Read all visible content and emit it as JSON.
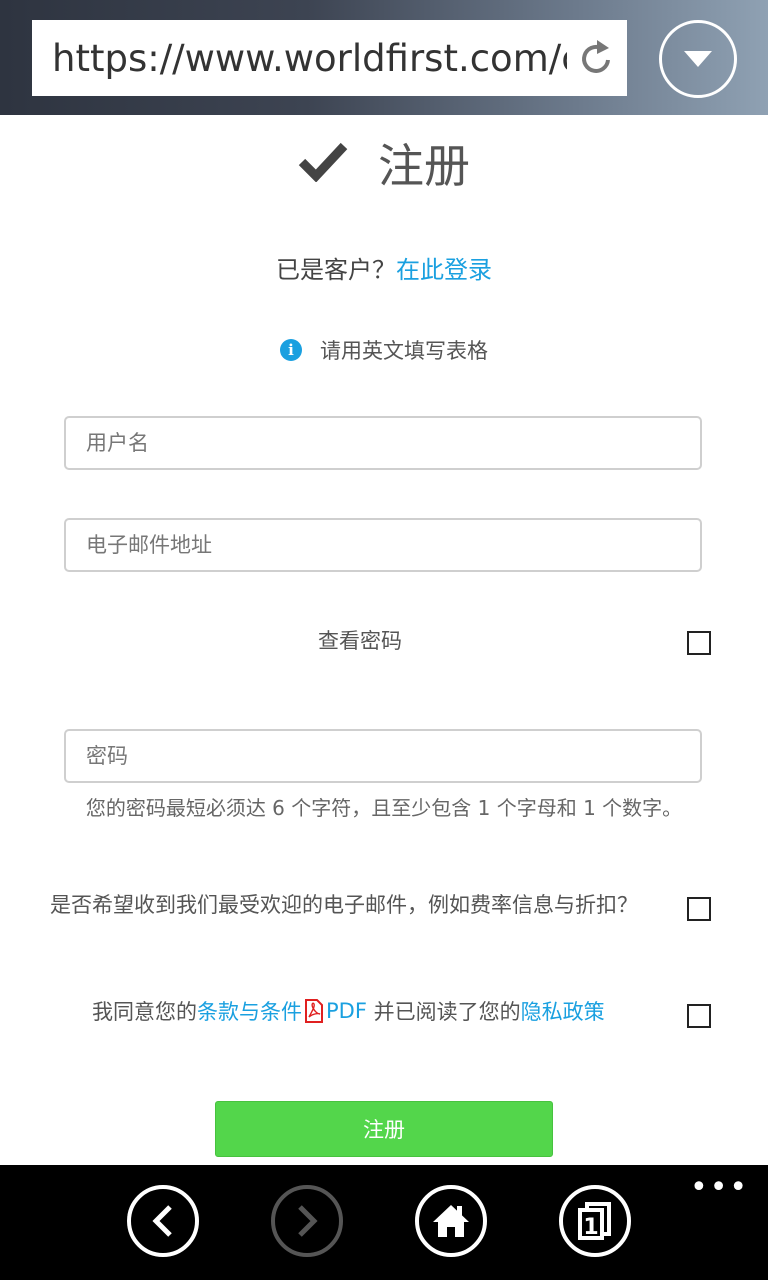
{
  "browser": {
    "url": "https://www.worldfirst.com/cr",
    "icons": {
      "refresh": "refresh-icon",
      "menu": "dropdown-arrow-icon"
    }
  },
  "page": {
    "title": "注册",
    "existing_customer_text": "已是客户？",
    "login_link": "在此登录",
    "hint_text": "请用英文填写表格",
    "username_placeholder": "用户名",
    "email_placeholder": "电子邮件地址",
    "show_password_label": "查看密码",
    "password_placeholder": "密码",
    "password_note": "您的密码最短必须达 6 个字符，且至少包含 1 个字母和 1 个数字。",
    "newsletter_label": "是否希望收到我们最受欢迎的电子邮件，例如费率信息与折扣？",
    "agree_prefix": "我同意您的",
    "terms_link": "条款与条件",
    "pdf_label": "PDF",
    "agree_middle": " 并已阅读了您的",
    "privacy_link": "隐私政策",
    "submit_label": "注册"
  },
  "colors": {
    "link": "#1aa0e0",
    "submit": "#53d64b",
    "pdf_icon": "#e02020"
  },
  "navbar": {
    "buttons": [
      "back-icon",
      "forward-icon",
      "home-icon",
      "tabs-icon"
    ],
    "tab_count": "1",
    "more": "•••"
  }
}
